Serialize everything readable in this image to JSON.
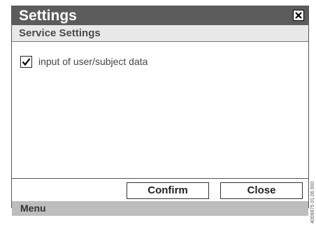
{
  "window": {
    "title": "Settings",
    "close_icon": "close-icon"
  },
  "section": {
    "title": "Service Settings"
  },
  "options": [
    {
      "label": "input of user/subject data",
      "checked": true
    }
  ],
  "buttons": {
    "confirm_label": "Confirm",
    "close_label": "Close"
  },
  "menubar": {
    "label": "Menu"
  },
  "side_code": "4009875 01 06 000",
  "colors": {
    "titlebar": "#5c5c5c",
    "subheader": "#e8e8e8",
    "menubar": "#bdbdbd"
  }
}
